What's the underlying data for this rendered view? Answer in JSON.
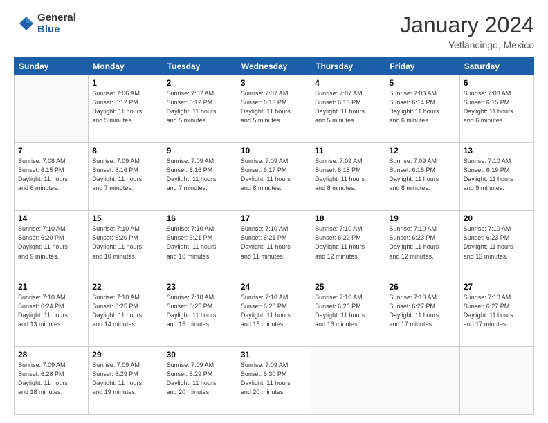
{
  "logo": {
    "general": "General",
    "blue": "Blue"
  },
  "title": "January 2024",
  "location": "Yetlancingo, Mexico",
  "days_of_week": [
    "Sunday",
    "Monday",
    "Tuesday",
    "Wednesday",
    "Thursday",
    "Friday",
    "Saturday"
  ],
  "weeks": [
    [
      {
        "day": "",
        "info": ""
      },
      {
        "day": "1",
        "info": "Sunrise: 7:06 AM\nSunset: 6:12 PM\nDaylight: 11 hours\nand 5 minutes."
      },
      {
        "day": "2",
        "info": "Sunrise: 7:07 AM\nSunset: 6:12 PM\nDaylight: 11 hours\nand 5 minutes."
      },
      {
        "day": "3",
        "info": "Sunrise: 7:07 AM\nSunset: 6:13 PM\nDaylight: 11 hours\nand 5 minutes."
      },
      {
        "day": "4",
        "info": "Sunrise: 7:07 AM\nSunset: 6:13 PM\nDaylight: 11 hours\nand 5 minutes."
      },
      {
        "day": "5",
        "info": "Sunrise: 7:08 AM\nSunset: 6:14 PM\nDaylight: 11 hours\nand 6 minutes."
      },
      {
        "day": "6",
        "info": "Sunrise: 7:08 AM\nSunset: 6:15 PM\nDaylight: 11 hours\nand 6 minutes."
      }
    ],
    [
      {
        "day": "7",
        "info": "Sunrise: 7:08 AM\nSunset: 6:15 PM\nDaylight: 11 hours\nand 6 minutes."
      },
      {
        "day": "8",
        "info": "Sunrise: 7:09 AM\nSunset: 6:16 PM\nDaylight: 11 hours\nand 7 minutes."
      },
      {
        "day": "9",
        "info": "Sunrise: 7:09 AM\nSunset: 6:16 PM\nDaylight: 11 hours\nand 7 minutes."
      },
      {
        "day": "10",
        "info": "Sunrise: 7:09 AM\nSunset: 6:17 PM\nDaylight: 11 hours\nand 8 minutes."
      },
      {
        "day": "11",
        "info": "Sunrise: 7:09 AM\nSunset: 6:18 PM\nDaylight: 11 hours\nand 8 minutes."
      },
      {
        "day": "12",
        "info": "Sunrise: 7:09 AM\nSunset: 6:18 PM\nDaylight: 11 hours\nand 8 minutes."
      },
      {
        "day": "13",
        "info": "Sunrise: 7:10 AM\nSunset: 6:19 PM\nDaylight: 11 hours\nand 9 minutes."
      }
    ],
    [
      {
        "day": "14",
        "info": "Sunrise: 7:10 AM\nSunset: 6:20 PM\nDaylight: 11 hours\nand 9 minutes."
      },
      {
        "day": "15",
        "info": "Sunrise: 7:10 AM\nSunset: 6:20 PM\nDaylight: 11 hours\nand 10 minutes."
      },
      {
        "day": "16",
        "info": "Sunrise: 7:10 AM\nSunset: 6:21 PM\nDaylight: 11 hours\nand 10 minutes."
      },
      {
        "day": "17",
        "info": "Sunrise: 7:10 AM\nSunset: 6:21 PM\nDaylight: 11 hours\nand 11 minutes."
      },
      {
        "day": "18",
        "info": "Sunrise: 7:10 AM\nSunset: 6:22 PM\nDaylight: 11 hours\nand 12 minutes."
      },
      {
        "day": "19",
        "info": "Sunrise: 7:10 AM\nSunset: 6:23 PM\nDaylight: 11 hours\nand 12 minutes."
      },
      {
        "day": "20",
        "info": "Sunrise: 7:10 AM\nSunset: 6:23 PM\nDaylight: 11 hours\nand 13 minutes."
      }
    ],
    [
      {
        "day": "21",
        "info": "Sunrise: 7:10 AM\nSunset: 6:24 PM\nDaylight: 11 hours\nand 13 minutes."
      },
      {
        "day": "22",
        "info": "Sunrise: 7:10 AM\nSunset: 6:25 PM\nDaylight: 11 hours\nand 14 minutes."
      },
      {
        "day": "23",
        "info": "Sunrise: 7:10 AM\nSunset: 6:25 PM\nDaylight: 11 hours\nand 15 minutes."
      },
      {
        "day": "24",
        "info": "Sunrise: 7:10 AM\nSunset: 6:26 PM\nDaylight: 11 hours\nand 15 minutes."
      },
      {
        "day": "25",
        "info": "Sunrise: 7:10 AM\nSunset: 6:26 PM\nDaylight: 11 hours\nand 16 minutes."
      },
      {
        "day": "26",
        "info": "Sunrise: 7:10 AM\nSunset: 6:27 PM\nDaylight: 11 hours\nand 17 minutes."
      },
      {
        "day": "27",
        "info": "Sunrise: 7:10 AM\nSunset: 6:27 PM\nDaylight: 11 hours\nand 17 minutes."
      }
    ],
    [
      {
        "day": "28",
        "info": "Sunrise: 7:09 AM\nSunset: 6:28 PM\nDaylight: 11 hours\nand 18 minutes."
      },
      {
        "day": "29",
        "info": "Sunrise: 7:09 AM\nSunset: 6:29 PM\nDaylight: 11 hours\nand 19 minutes."
      },
      {
        "day": "30",
        "info": "Sunrise: 7:09 AM\nSunset: 6:29 PM\nDaylight: 11 hours\nand 20 minutes."
      },
      {
        "day": "31",
        "info": "Sunrise: 7:09 AM\nSunset: 6:30 PM\nDaylight: 11 hours\nand 20 minutes."
      },
      {
        "day": "",
        "info": ""
      },
      {
        "day": "",
        "info": ""
      },
      {
        "day": "",
        "info": ""
      }
    ]
  ]
}
